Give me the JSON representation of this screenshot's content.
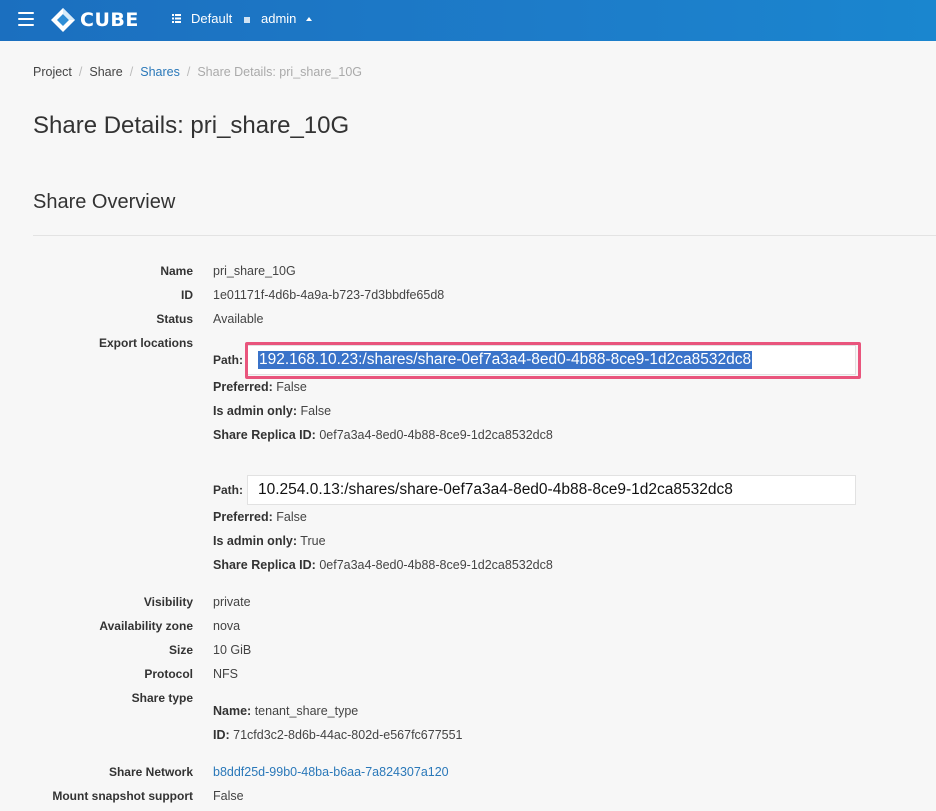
{
  "header": {
    "logo_text": "CUBE",
    "project_label": "Default",
    "user_label": "admin"
  },
  "breadcrumb": {
    "items": [
      "Project",
      "Share",
      "Shares",
      "Share Details: pri_share_10G"
    ]
  },
  "page_title": "Share Details: pri_share_10G",
  "section_title": "Share Overview",
  "overview": {
    "name_label": "Name",
    "name_value": "pri_share_10G",
    "id_label": "ID",
    "id_value": "1e01171f-4d6b-4a9a-b723-7d3bbdfe65d8",
    "status_label": "Status",
    "status_value": "Available",
    "export_label": "Export locations",
    "exports": [
      {
        "path_label": "Path:",
        "path_value": "192.168.10.23:/shares/share-0ef7a3a4-8ed0-4b88-8ce9-1d2ca8532dc8",
        "preferred_label": "Preferred:",
        "preferred_value": "False",
        "admin_label": "Is admin only:",
        "admin_value": "False",
        "replica_label": "Share Replica ID:",
        "replica_value": "0ef7a3a4-8ed0-4b88-8ce9-1d2ca8532dc8"
      },
      {
        "path_label": "Path:",
        "path_value": "10.254.0.13:/shares/share-0ef7a3a4-8ed0-4b88-8ce9-1d2ca8532dc8",
        "preferred_label": "Preferred:",
        "preferred_value": "False",
        "admin_label": "Is admin only:",
        "admin_value": "True",
        "replica_label": "Share Replica ID:",
        "replica_value": "0ef7a3a4-8ed0-4b88-8ce9-1d2ca8532dc8"
      }
    ],
    "visibility_label": "Visibility",
    "visibility_value": "private",
    "az_label": "Availability zone",
    "az_value": "nova",
    "size_label": "Size",
    "size_value": "10 GiB",
    "protocol_label": "Protocol",
    "protocol_value": "NFS",
    "share_type_label": "Share type",
    "share_type_name_label": "Name:",
    "share_type_name_value": "tenant_share_type",
    "share_type_id_label": "ID:",
    "share_type_id_value": "71cfd3c2-8d6b-44ac-802d-e567fc677551",
    "network_label": "Share Network",
    "network_value": "b8ddf25d-99b0-48ba-b6aa-7a824307a120",
    "mount_label": "Mount snapshot support",
    "mount_value": "False"
  },
  "colors": {
    "topbar": "#1d7cc9",
    "link": "#2a78b9",
    "highlight": "#e9557d",
    "selection": "#3a73c9"
  }
}
